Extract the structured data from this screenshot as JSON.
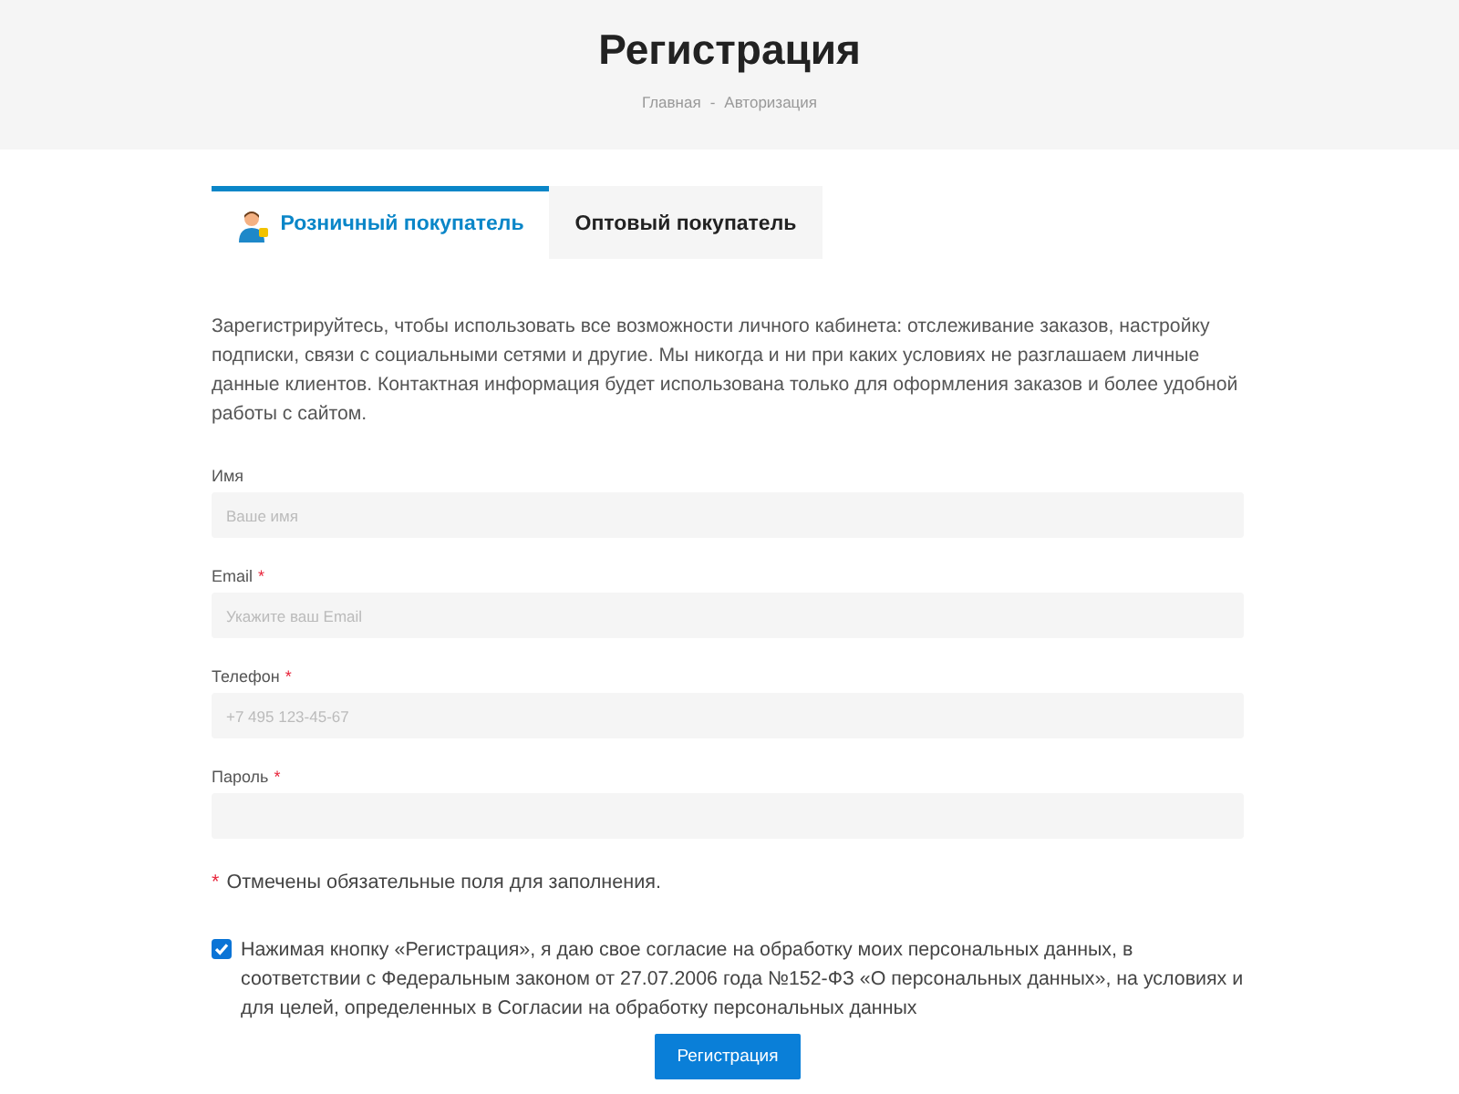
{
  "header": {
    "title": "Регистрация",
    "breadcrumbs": [
      "Главная",
      "Авторизация"
    ],
    "separator": "-"
  },
  "tabs": [
    {
      "label": "Розничный покупатель",
      "selected": true
    },
    {
      "label": "Оптовый покупатель",
      "selected": false
    }
  ],
  "intro": "Зарегистрируйтесь, чтобы использовать все возможности личного кабинета: отслеживание заказов, настройку подписки, связи с социальными сетями и другие. Мы никогда и ни при каких условиях не разглашаем личные данные клиентов. Контактная информация будет использована только для оформления заказов и более удобной работы с сайтом.",
  "fields": [
    {
      "label": "Имя",
      "required": false,
      "placeholder": "Ваше имя"
    },
    {
      "label": "Email",
      "required": true,
      "placeholder": "Укажите ваш Email"
    },
    {
      "label": "Телефон",
      "required": true,
      "placeholder": "+7 495 123-45-67"
    },
    {
      "label": "Пароль",
      "required": true
    }
  ],
  "required_note": {
    "mark": "*",
    "text": "Отмечены обязательные поля для заполнения."
  },
  "consent": {
    "checked": true,
    "text": "Нажимая кнопку «Регистрация», я даю свое согласие на обработку моих персональных данных, в соответствии с Федеральным законом от 27.07.2006 года №152-ФЗ «О персональных данных», на условиях и для целей, определенных в Согласии на обработку персональных данных"
  },
  "submit": "Регистрация"
}
